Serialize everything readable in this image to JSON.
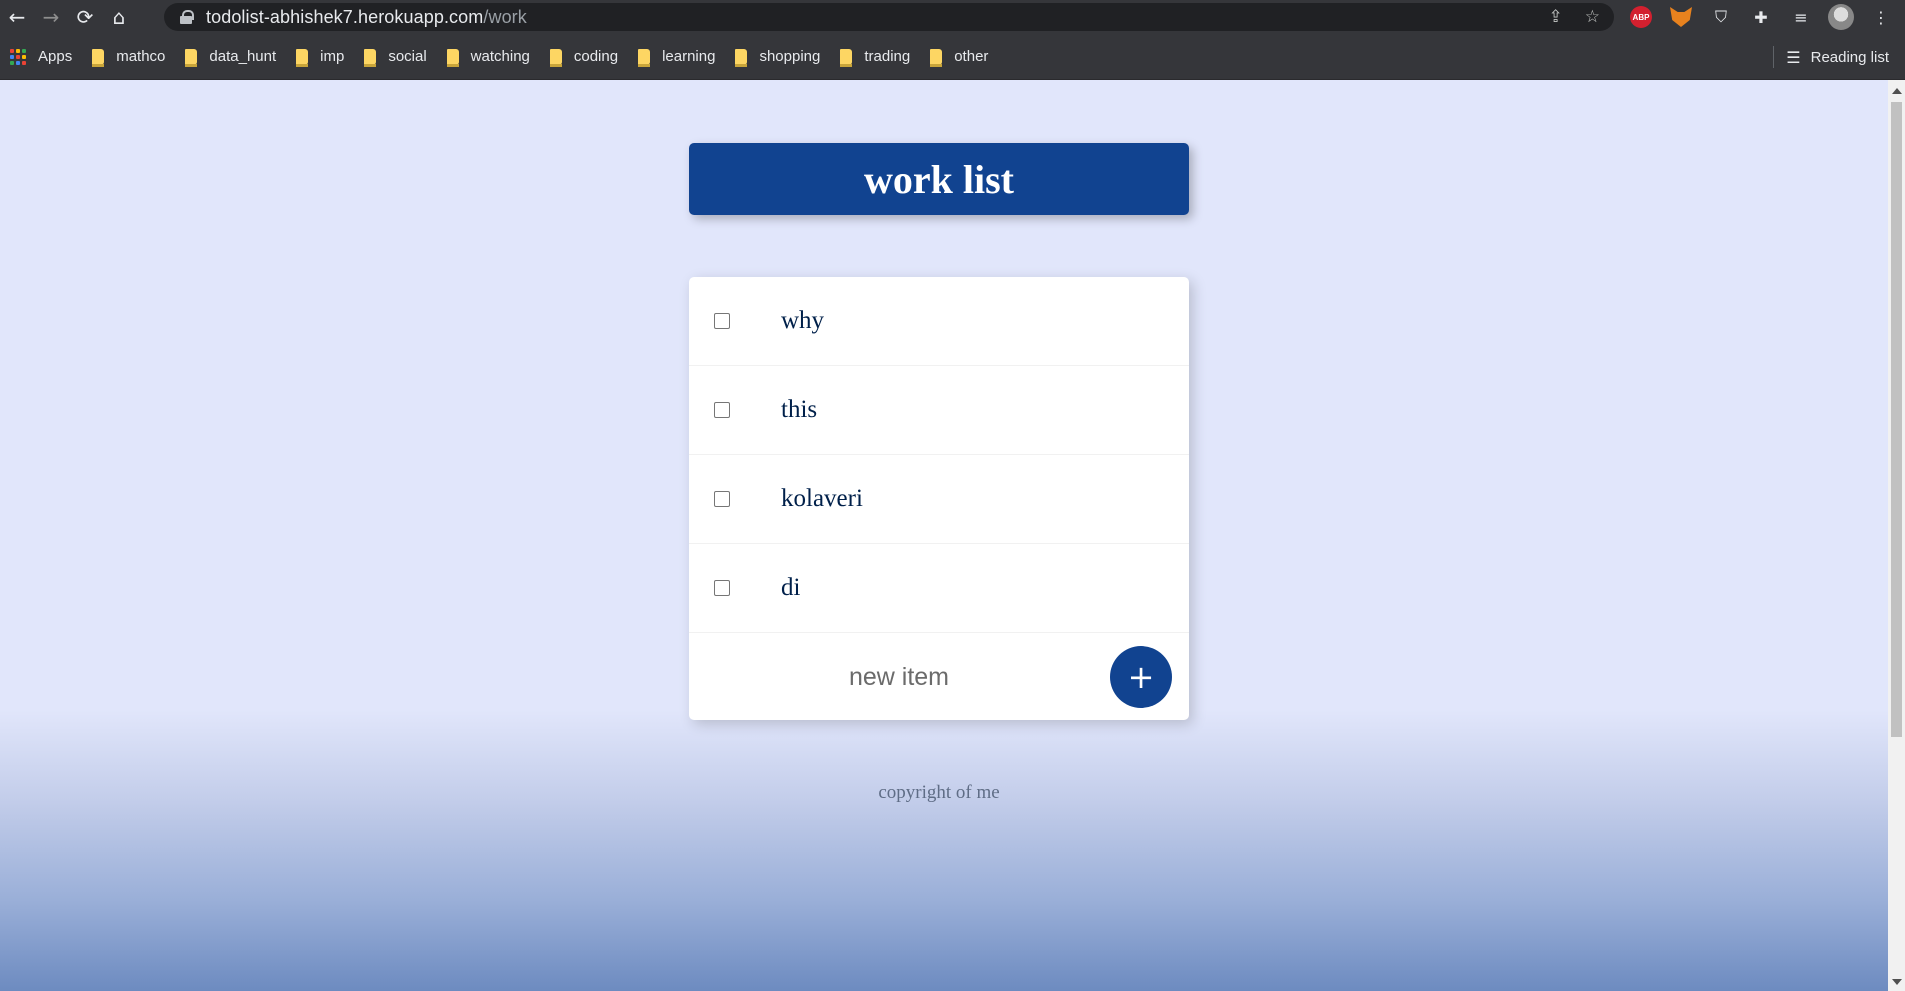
{
  "browser": {
    "url_host": "todolist-abhishek7.herokuapp.com",
    "url_path": "/work",
    "nav_icons": {
      "back": "←",
      "forward": "→",
      "reload": "⟳",
      "home": "⌂"
    },
    "omnibox_icons": {
      "share": "⇪",
      "star": "☆"
    },
    "extensions": {
      "abp_label": "ABP",
      "shield": "⛉",
      "puzzle": "✚",
      "media": "≡",
      "menu": "⋮"
    }
  },
  "bookmarks": {
    "apps_label": "Apps",
    "items": [
      "mathco",
      "data_hunt",
      "imp",
      "social",
      "watching",
      "coding",
      "learning",
      "shopping",
      "trading",
      "other"
    ],
    "reading_list_label": "Reading list",
    "reading_list_icon": "☰"
  },
  "page": {
    "title": "work list",
    "items": [
      "why",
      "this",
      "kolaveri",
      "di"
    ],
    "new_item_placeholder": "new item",
    "add_button_label": "+",
    "footer": "copyright of me",
    "accent_color": "#114390",
    "background_color": "#e1e6fb"
  }
}
